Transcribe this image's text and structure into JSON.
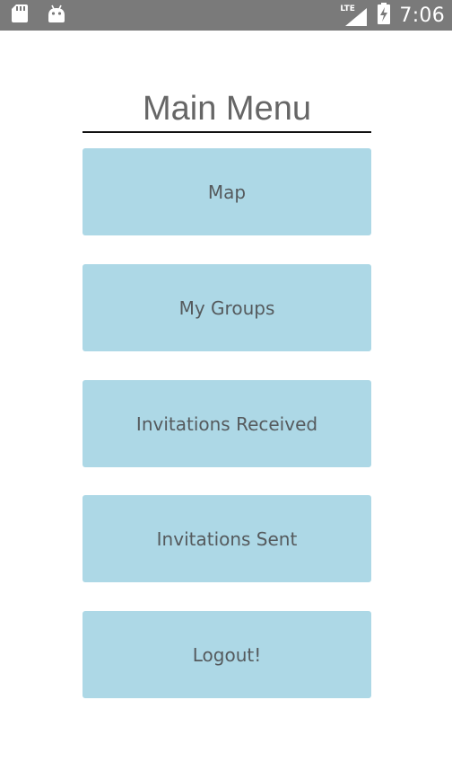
{
  "status_bar": {
    "time": "7:06",
    "network": "LTE",
    "icons": [
      "sd-card-icon",
      "android-icon",
      "signal-icon",
      "battery-charging-icon"
    ]
  },
  "main_menu": {
    "title": "Main Menu",
    "buttons": [
      {
        "label": "Map"
      },
      {
        "label": "My Groups"
      },
      {
        "label": "Invitations Received"
      },
      {
        "label": "Invitations Sent"
      },
      {
        "label": "Logout!"
      }
    ]
  },
  "colors": {
    "status_bar_bg": "#7a7a7a",
    "button_bg": "#add8e6",
    "button_text": "#555a5d",
    "title_text": "#666666"
  }
}
